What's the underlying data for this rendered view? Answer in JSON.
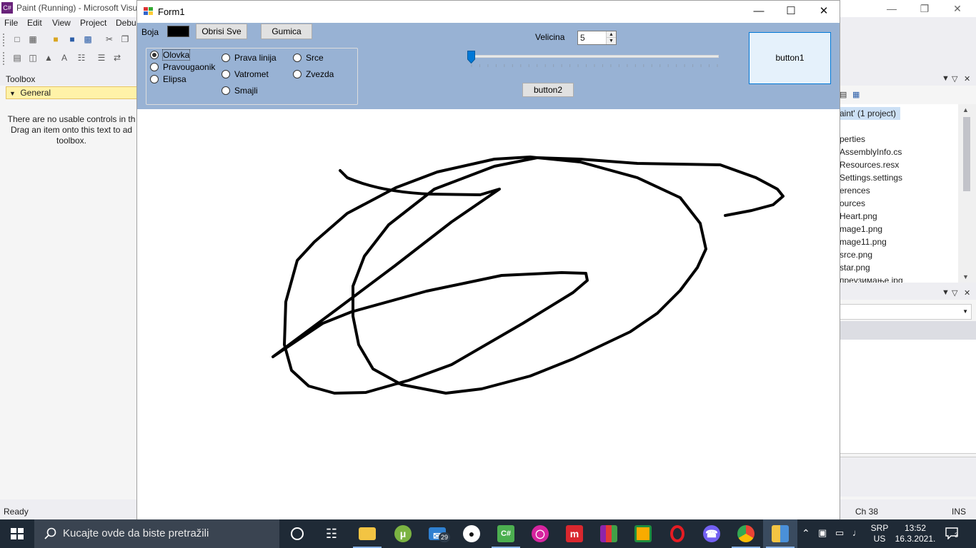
{
  "vs": {
    "title": "Paint (Running) - Microsoft Visu",
    "menu": [
      "File",
      "Edit",
      "View",
      "Project",
      "Debu"
    ],
    "toolbox": {
      "title": "Toolbox",
      "group": "General",
      "message": "There are no usable controls in th\nDrag an item onto this text to ad\ntoolbox."
    },
    "solution_items": [
      "aint' (1 project)",
      "perties",
      "AssemblyInfo.cs",
      "Resources.resx",
      "Settings.settings",
      "erences",
      "ources",
      "Heart.png",
      "mage1.png",
      "mage11.png",
      "srce.png",
      "star.png",
      "преузимање.jpg"
    ],
    "status": {
      "ready": "Ready",
      "ch": "Ch 38",
      "mode": "INS"
    }
  },
  "form": {
    "title": "Form1",
    "boja_label": "Boja",
    "selected_color": "#000000",
    "obrisi_label": "Obrisi Sve",
    "gumica_label": "Gumica",
    "radios": [
      {
        "label": "Olovka",
        "checked": true
      },
      {
        "label": "Pravougaonik",
        "checked": false
      },
      {
        "label": "Elipsa",
        "checked": false
      },
      {
        "label": "Prava linija",
        "checked": false
      },
      {
        "label": "Vatromet",
        "checked": false
      },
      {
        "label": "Smajli",
        "checked": false
      },
      {
        "label": "Srce",
        "checked": false
      },
      {
        "label": "Zvezda",
        "checked": false
      }
    ],
    "velicina_label": "Velicina",
    "velicina_value": "5",
    "slider": {
      "value": 0,
      "min": 0,
      "max": 1
    },
    "button1_label": "button1",
    "button2_label": "button2",
    "panel_color": "#98b2d4"
  },
  "taskbar": {
    "search_placeholder": "Kucajte ovde da biste pretražili",
    "mail_badge": "29",
    "language": "SRP",
    "layout": "US",
    "time": "13:52",
    "date": "16.3.2021.",
    "notifications": "3",
    "apps": [
      "cortana-icon",
      "task-view-icon",
      "file-explorer-icon",
      "utorrent-icon",
      "mail-icon",
      "github-icon",
      "visual-studio-icon",
      "instagram-icon",
      "mega-icon",
      "winrar-icon",
      "classroom-icon",
      "opera-icon",
      "viber-icon",
      "chrome-icon",
      "paint-app-icon"
    ]
  }
}
